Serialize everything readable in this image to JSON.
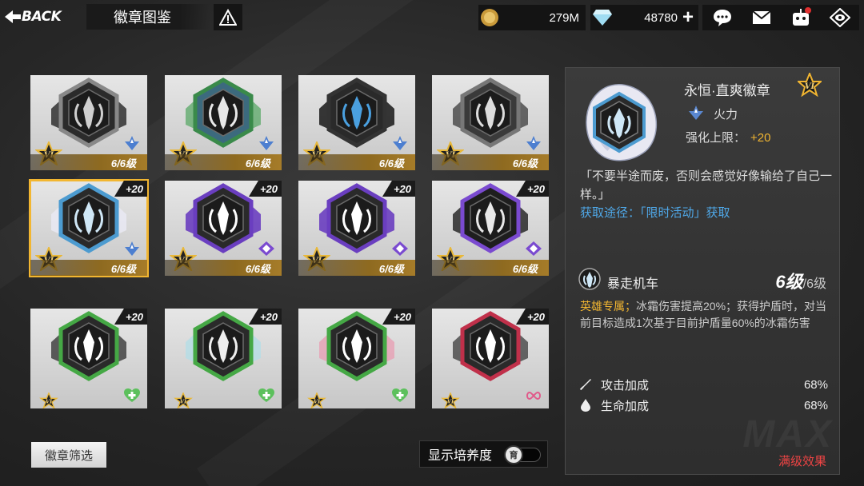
{
  "header": {
    "back_label": "BACK",
    "title": "徽章图鉴"
  },
  "resources": {
    "coin": "279M",
    "gem": "48780",
    "plus": "+"
  },
  "cards": [
    {
      "level": "6/6级",
      "plus": ""
    },
    {
      "level": "6/6级",
      "plus": ""
    },
    {
      "level": "6/6级",
      "plus": ""
    },
    {
      "level": "6/6级",
      "plus": ""
    },
    {
      "level": "6/6级",
      "plus": "+20"
    },
    {
      "level": "6/6级",
      "plus": "+20"
    },
    {
      "level": "6/6级",
      "plus": "+20"
    },
    {
      "level": "6/6级",
      "plus": "+20"
    },
    {
      "level": "",
      "plus": "+20"
    },
    {
      "level": "",
      "plus": "+20"
    },
    {
      "level": "",
      "plus": "+20"
    },
    {
      "level": "",
      "plus": "+20"
    }
  ],
  "filter_label": "徽章筛选",
  "show_development_label": "显示培养度",
  "toggle_glyph": "育",
  "detail": {
    "name": "永恒·直爽徽章",
    "rank": "VI",
    "type": "火力",
    "limit_label": "强化上限：",
    "limit_value": "+20",
    "quote": "「不要半途而废，否则会感觉好像输给了自己一样。」",
    "source": "获取途径：「限时活动」获取",
    "skill_name": "暴走机车",
    "skill_level": "6级",
    "skill_max": "/6级",
    "desc_highlight": "英雄专属；",
    "desc_text": "冰霜伤害提高20%；获得护盾时，对当前目标造成1次基于目前护盾量60%的冰霜伤害",
    "stats": [
      {
        "label": "攻击加成",
        "value": "68%"
      },
      {
        "label": "生命加成",
        "value": "68%"
      }
    ],
    "max_effect": "满级效果",
    "watermark": "MAX"
  },
  "colors": {
    "accent_gold": "#f1b531",
    "link_blue": "#4fa8e8",
    "alert_red": "#e44444",
    "selected_outline": "#f2b631"
  },
  "icons": {
    "type_fire": "arrow-up-icon",
    "type_purple": "purple-diamond-icon",
    "type_green": "green-heart-icon",
    "type_pink": "infinity-icon"
  }
}
